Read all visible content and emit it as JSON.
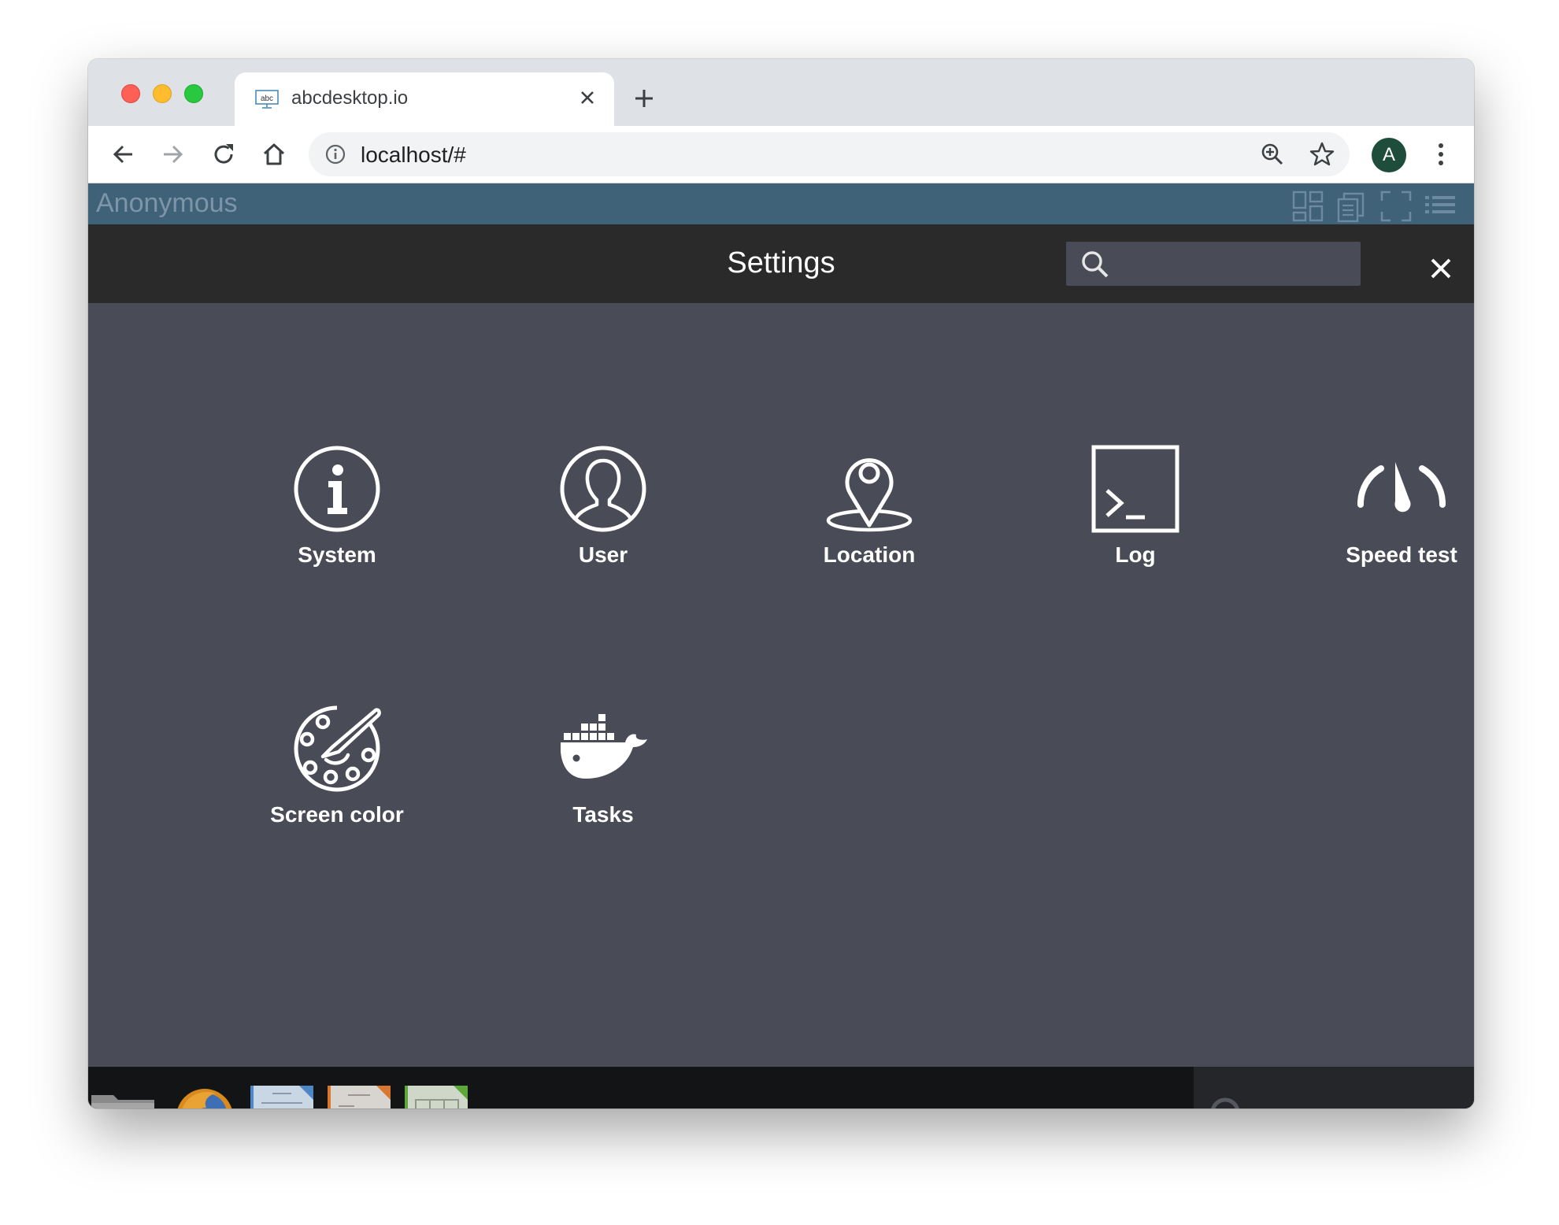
{
  "browser": {
    "tab_title": "abcdesktop.io",
    "favicon_text": "abc",
    "url": "localhost/#",
    "avatar_letter": "A",
    "icons": [
      "back-icon",
      "forward-icon",
      "reload-icon",
      "home-icon",
      "info-icon",
      "zoom-icon",
      "star-icon",
      "kebab-menu-icon",
      "close-icon",
      "plus-icon"
    ]
  },
  "app": {
    "user_name": "Anonymous",
    "top_icons": [
      "grid-view-icon",
      "documents-icon",
      "fullscreen-icon",
      "list-menu-icon"
    ],
    "colors": {
      "topbar": "#3f6279",
      "header": "#2a2a2a",
      "panel": "#494c56",
      "dock": "#131415"
    }
  },
  "settings": {
    "title": "Settings",
    "search_placeholder": "",
    "items": [
      {
        "label": "System",
        "icon": "info-icon"
      },
      {
        "label": "User",
        "icon": "user-icon"
      },
      {
        "label": "Location",
        "icon": "location-pin-icon"
      },
      {
        "label": "Log",
        "icon": "terminal-icon"
      },
      {
        "label": "Speed test",
        "icon": "speedometer-icon"
      },
      {
        "label": "Screen color",
        "icon": "palette-icon"
      },
      {
        "label": "Tasks",
        "icon": "docker-whale-icon"
      }
    ]
  },
  "dock": {
    "items": [
      "home-folder-icon",
      "firefox-icon",
      "writer-document-icon",
      "impress-presentation-icon",
      "calc-spreadsheet-icon"
    ],
    "search_icon": "search-icon"
  }
}
